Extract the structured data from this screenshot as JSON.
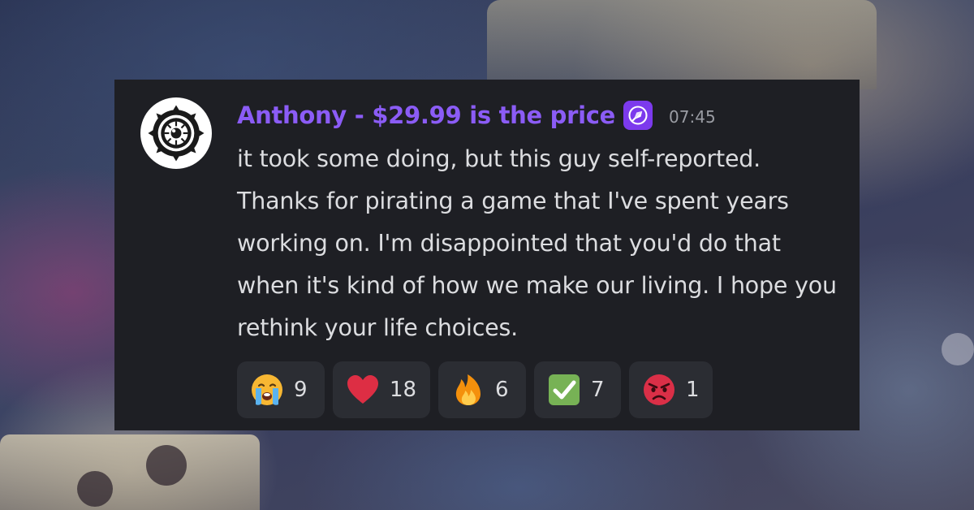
{
  "message": {
    "author": "Anthony - $29.99 is the price",
    "badge_icon": "rocket-badge-icon",
    "timestamp": "07:45",
    "text": "it took some doing, but this guy self-reported. Thanks for pirating a game that I've spent years working on. I'm disappointed that you'd do that when it's kind of how we make our living. I hope you rethink your life choices.",
    "author_color": "#8b5cf6"
  },
  "reactions": [
    {
      "emoji": "loudly-crying-face",
      "count": "9"
    },
    {
      "emoji": "red-heart",
      "count": "18"
    },
    {
      "emoji": "fire",
      "count": "6"
    },
    {
      "emoji": "white-check-mark",
      "count": "7"
    },
    {
      "emoji": "angry-face",
      "count": "1"
    }
  ]
}
